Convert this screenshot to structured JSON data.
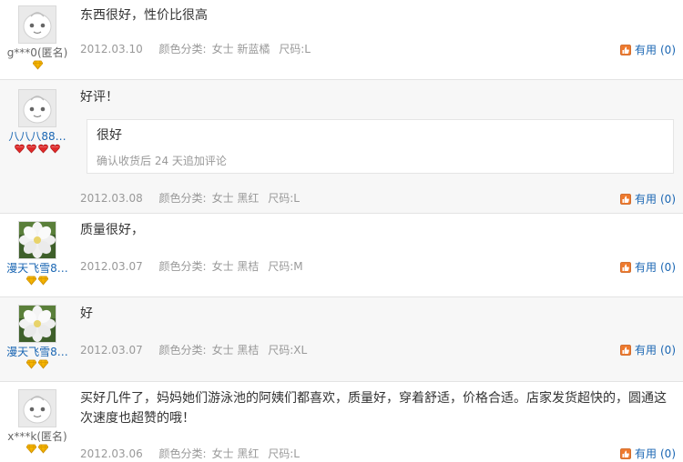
{
  "reviews": [
    {
      "user": "g***0(匿名)",
      "avatar": "default-face-icon",
      "rank_icon": "gold-diamond-icon",
      "rank_count": 1,
      "content": "东西很好，性价比很高",
      "date": "2012.03.10",
      "color_label": "颜色分类:",
      "color_value": "女士 新蓝橘",
      "size_label": "尺码:",
      "size_value": "L",
      "useful_label": "有用",
      "useful_count": "(0)"
    },
    {
      "user": "八八八88…",
      "avatar": "default-face-icon",
      "rank_icon": "red-heart-icon",
      "rank_count": 4,
      "content": "好评！",
      "followup": {
        "text": "很好",
        "meta": "确认收货后 24 天追加评论"
      },
      "date": "2012.03.08",
      "color_label": "颜色分类:",
      "color_value": "女士 黑红",
      "size_label": "尺码:",
      "size_value": "L",
      "useful_label": "有用",
      "useful_count": "(0)"
    },
    {
      "user": "漫天飞雪8…",
      "avatar": "white-flower-photo",
      "rank_icon": "gold-diamond-icon",
      "rank_count": 2,
      "content": "质量很好，",
      "date": "2012.03.07",
      "color_label": "颜色分类:",
      "color_value": "女士 黑桔",
      "size_label": "尺码:",
      "size_value": "M",
      "useful_label": "有用",
      "useful_count": "(0)"
    },
    {
      "user": "漫天飞雪8…",
      "avatar": "white-flower-photo",
      "rank_icon": "gold-diamond-icon",
      "rank_count": 2,
      "content": "好",
      "date": "2012.03.07",
      "color_label": "颜色分类:",
      "color_value": "女士 黑桔",
      "size_label": "尺码:",
      "size_value": "XL",
      "useful_label": "有用",
      "useful_count": "(0)"
    },
    {
      "user": "x***k(匿名)",
      "avatar": "default-face-icon",
      "rank_icon": "gold-diamond-icon",
      "rank_count": 2,
      "content": "买好几件了，妈妈她们游泳池的阿姨们都喜欢，质量好，穿着舒适，价格合适。店家发货超快的，圆通这次速度也超赞的哦！",
      "date": "2012.03.06",
      "color_label": "颜色分类:",
      "color_value": "女士 黑红",
      "size_label": "尺码:",
      "size_value": "L",
      "useful_label": "有用",
      "useful_count": "(0)"
    }
  ],
  "colors": {
    "link": "#1a66b3",
    "meta_text": "#999999",
    "diamond": "#f5b400",
    "heart": "#e02a2a",
    "useful_icon": "#ee7a2e"
  }
}
